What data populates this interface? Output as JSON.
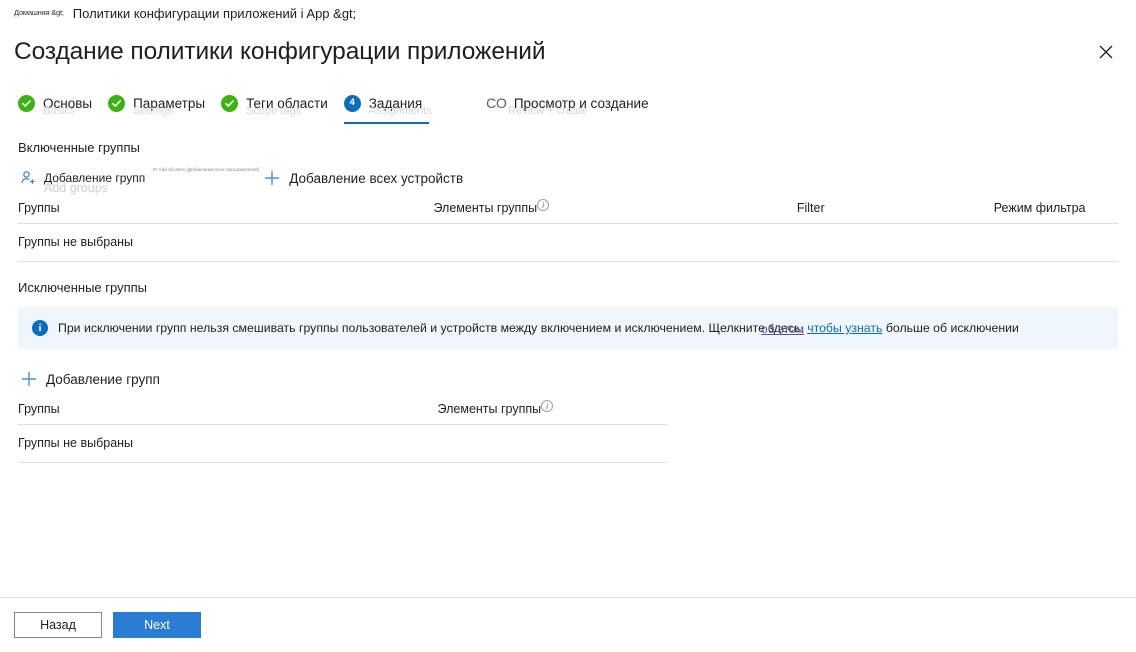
{
  "breadcrumb": {
    "home": "Домашняя &gt;",
    "current": "Политики конфигурации приложений i App &gt;"
  },
  "page": {
    "title": "Создание политики конфигурации приложений",
    "close_icon": "close-icon"
  },
  "tabs": [
    {
      "label": "Основы",
      "state": "done",
      "ghost": "Basics"
    },
    {
      "label": "Параметры",
      "state": "done",
      "ghost": "Settings"
    },
    {
      "label": "Теги области",
      "state": "done",
      "ghost": "Scope tags"
    },
    {
      "label": "Задания",
      "state": "active",
      "badge": "4",
      "ghost": "Assignments"
    },
    {
      "label": "Просмотр и создание",
      "state": "pending",
      "badge": "СО",
      "ghost": "Review + create"
    }
  ],
  "included": {
    "section_label": "Включенные группы",
    "add_groups": {
      "label": "Добавление групп",
      "ghost": "Add groups",
      "micro_ghost": "Pr Add all users (Добавление всех пользователей)",
      "icon": "person-add-icon"
    },
    "add_all_devices": {
      "label": "Добавление всех устройств",
      "icon": "plus-icon"
    },
    "columns": [
      "Группы",
      "Элементы группы",
      "Filter",
      "Режим фильтра"
    ],
    "empty_row": "Группы не выбраны"
  },
  "excluded": {
    "section_label": "Исключенные группы",
    "banner": {
      "icon": "info-icon",
      "text_before": "При исключении групп нельзя смешивать группы пользователей и устройств между включением и исключением. Щелкните здесь, ",
      "link_text": "чтобы узнать",
      "text_after": " больше об исключении",
      "ghost": "об этом"
    },
    "add_groups": {
      "label": "Добавление групп",
      "icon": "plus-icon"
    },
    "columns": [
      "Группы",
      "Элементы группы"
    ],
    "empty_row": "Группы не выбраны"
  },
  "footer": {
    "back_label": "Назад",
    "next_label": "Next"
  },
  "colors": {
    "accent_blue": "#0f6cbd",
    "primary_button": "#2b7cd3",
    "success_green": "#3db313",
    "banner_bg": "#eff6fc",
    "border": "#e1dfdd"
  }
}
